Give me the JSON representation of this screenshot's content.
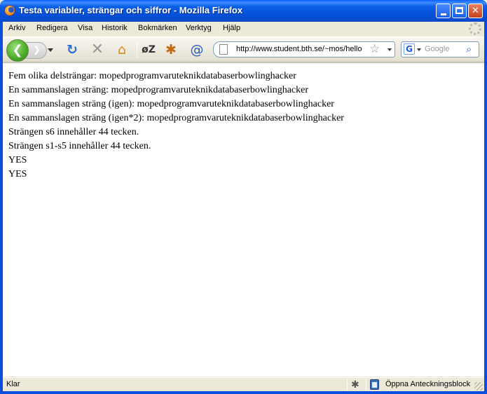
{
  "window": {
    "title": "Testa variabler, strängar och siffror - Mozilla Firefox"
  },
  "menu": {
    "items": [
      "Arkiv",
      "Redigera",
      "Visa",
      "Historik",
      "Bokmärken",
      "Verktyg",
      "Hjälp"
    ]
  },
  "toolbar": {
    "back_glyph": "❮",
    "forward_glyph": "❯",
    "reload_glyph": "↻",
    "stop_glyph": "✕",
    "home_glyph": "⌂",
    "icons": [
      "back-icon",
      "forward-icon",
      "reload-icon",
      "stop-icon",
      "home-icon",
      "extension-icon",
      "firebug-icon",
      "web-developer-icon"
    ]
  },
  "address_bar": {
    "url": "http://www.student.bth.se/~mos/hello"
  },
  "search_bar": {
    "engine_glyph": "G",
    "placeholder": "Google"
  },
  "content": {
    "lines": [
      "Fem olika delsträngar: mopedprogramvaruteknikdatabaserbowlinghacker",
      "En sammanslagen sträng: mopedprogramvaruteknikdatabaserbowlinghacker",
      "En sammanslagen sträng (igen): mopedprogramvaruteknikdatabaserbowlinghacker",
      "En sammanslagen sträng (igen*2): mopedprogramvaruteknikdatabaserbowlinghacker",
      "Strängen s6 innehåller 44 tecken.",
      "Strängen s1-s5 innehåller 44 tecken.",
      "YES",
      "YES"
    ]
  },
  "status": {
    "text": "Klar",
    "notepad_label": "Öppna Anteckningsblock"
  },
  "colors": {
    "titlebar": "#0a5fe6",
    "chrome": "#ece9d8",
    "content_bg": "#ffffff"
  }
}
